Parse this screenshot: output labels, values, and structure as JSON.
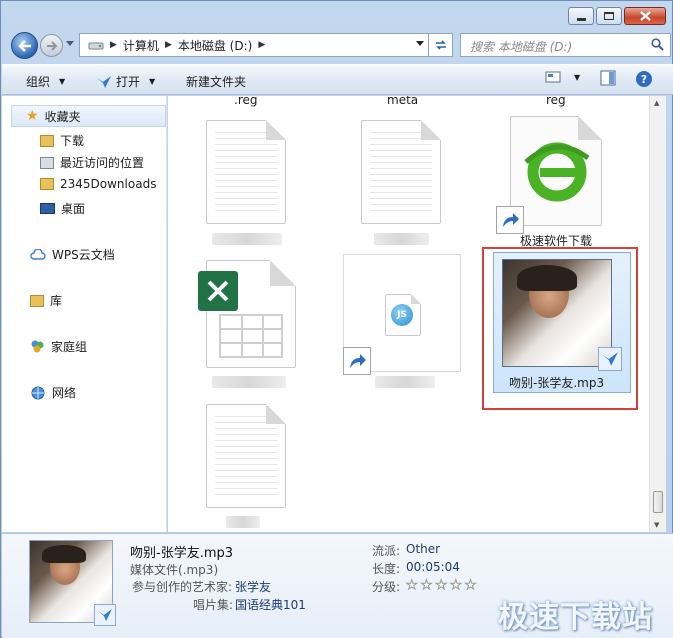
{
  "window": {
    "caption_icons": [
      "minimize-icon",
      "maximize-icon",
      "close-icon"
    ]
  },
  "address": {
    "crumbs": [
      "计算机",
      "本地磁盘 (D:)"
    ],
    "search_placeholder": "搜索 本地磁盘 (D:)"
  },
  "toolbar": {
    "organize": "组织",
    "open": "打开",
    "new_folder": "新建文件夹"
  },
  "nav": {
    "favorites": "收藏夹",
    "downloads": "下载",
    "recent": "最近访问的位置",
    "downloads2345": "2345Downloads",
    "desktop": "桌面",
    "wps": "WPS云文档",
    "library": "库",
    "homegroup": "家庭组",
    "network": "网络"
  },
  "files": {
    "top_labels": [
      ".reg",
      "meta",
      "reg"
    ],
    "ie_shortcut": "极速软件下载",
    "mp3": "吻别-张学友.mp3"
  },
  "details": {
    "name": "吻别-张学友.mp3",
    "type": "媒体文件(.mp3)",
    "artist_key": "参与创作的艺术家:",
    "artist_val": "张学友",
    "album_key": "唱片集:",
    "album_val": "国语经典101",
    "genre_key": "流派:",
    "genre_val": "Other",
    "length_key": "长度:",
    "length_val": "00:05:04",
    "rating_key": "分级:",
    "rating_stars": 0
  },
  "watermark": "极速下载站",
  "colors": {
    "selection_border": "#84acdd",
    "highlight_box": "#d4403a",
    "excel_green": "#217346",
    "ie_green": "#49b325"
  }
}
